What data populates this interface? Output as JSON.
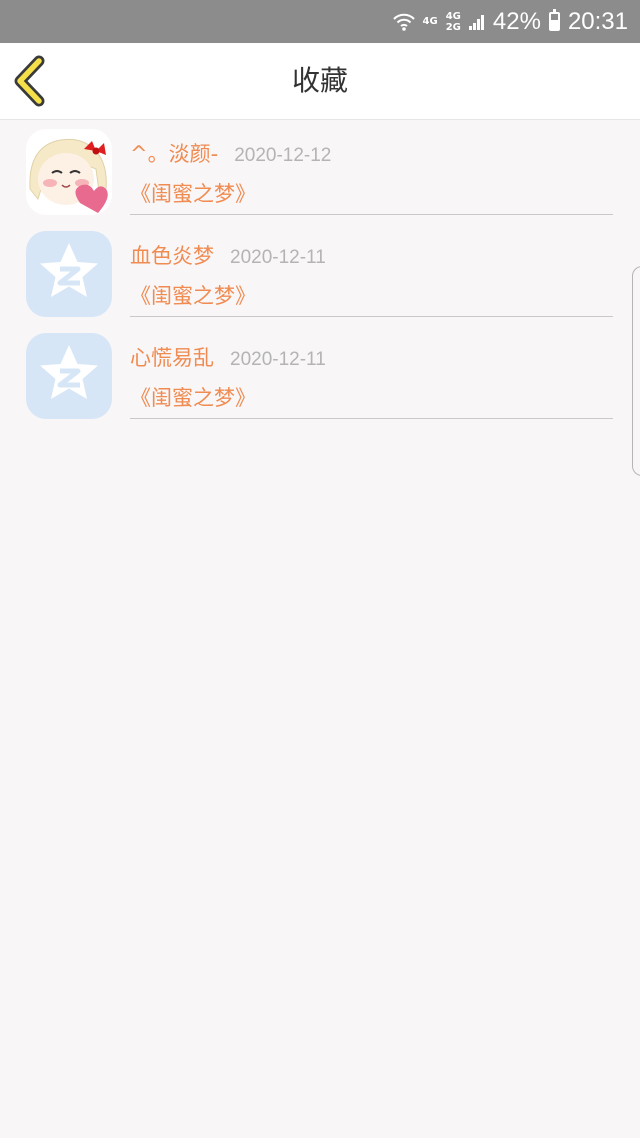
{
  "status_bar": {
    "network_top": "4G",
    "network_bottom": "2G",
    "network_single": "4G",
    "battery": "42%",
    "time": "20:31"
  },
  "header": {
    "title": "收藏",
    "back_icon": "chevron-left-icon"
  },
  "colors": {
    "accent": "#f08b51",
    "date": "#b4b4b4",
    "status_bar": "#8c8c8c",
    "back_icon": "#f5e04a"
  },
  "favorites": [
    {
      "user": "^。淡颜-",
      "date": "2020-12-12",
      "book": "《闺蜜之梦》",
      "avatar": "cartoon-girl-avatar"
    },
    {
      "user": "血色炎梦",
      "date": "2020-12-11",
      "book": "《闺蜜之梦》",
      "avatar": "qzone-star-avatar"
    },
    {
      "user": "心慌易乱",
      "date": "2020-12-11",
      "book": "《闺蜜之梦》",
      "avatar": "qzone-star-avatar"
    }
  ]
}
